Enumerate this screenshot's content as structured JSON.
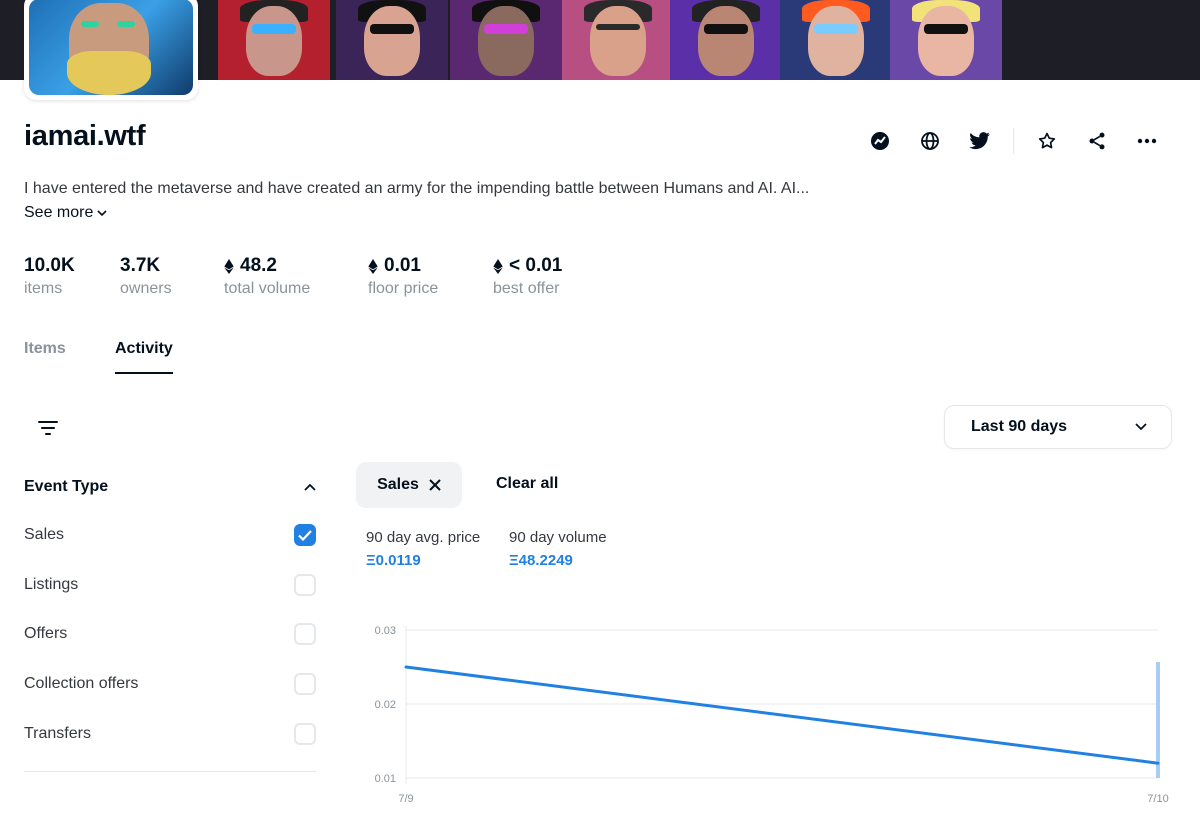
{
  "collection": {
    "name": "iamai.wtf",
    "description": "I have entered the metaverse and have created an army for the impending battle between Humans and AI. AI...",
    "see_more": "See more"
  },
  "header_actions": [
    {
      "name": "activity-link-icon"
    },
    {
      "name": "globe-icon"
    },
    {
      "name": "twitter-icon"
    },
    {
      "name": "star-icon"
    },
    {
      "name": "share-icon"
    },
    {
      "name": "more-icon"
    }
  ],
  "stats": [
    {
      "value": "10.0K",
      "label": "items",
      "eth": false
    },
    {
      "value": "3.7K",
      "label": "owners",
      "eth": false
    },
    {
      "value": "48.2",
      "label": "total volume",
      "eth": true
    },
    {
      "value": "0.01",
      "label": "floor price",
      "eth": true
    },
    {
      "value": "< 0.01",
      "label": "best offer",
      "eth": true
    }
  ],
  "tabs": {
    "items": "Items",
    "activity": "Activity",
    "active": "Activity"
  },
  "range_dropdown": {
    "selected": "Last 90 days"
  },
  "event_type": {
    "title": "Event Type",
    "options": [
      {
        "label": "Sales",
        "checked": true
      },
      {
        "label": "Listings",
        "checked": false
      },
      {
        "label": "Offers",
        "checked": false
      },
      {
        "label": "Collection offers",
        "checked": false
      },
      {
        "label": "Transfers",
        "checked": false
      }
    ]
  },
  "filters": {
    "chip_label": "Sales",
    "clear_all": "Clear all"
  },
  "metrics": {
    "avg_price_label": "90 day avg. price",
    "avg_price_value": "Ξ0.0119",
    "volume_label": "90 day volume",
    "volume_value": "Ξ48.2249"
  },
  "colors": {
    "accent": "#2081e2",
    "text": "#04111d",
    "muted": "#8a939b",
    "border": "#e5e8eb",
    "line": "#2081e2"
  },
  "chart_data": {
    "type": "line",
    "x": [
      "7/9",
      "7/10"
    ],
    "series": [
      {
        "values": [
          0.025,
          0.012
        ]
      }
    ],
    "volume_bar": {
      "x": "7/10"
    },
    "yticks": [
      "0.03",
      "0.02",
      "0.01"
    ],
    "ylim": [
      0.01,
      0.03
    ],
    "grid": true
  }
}
